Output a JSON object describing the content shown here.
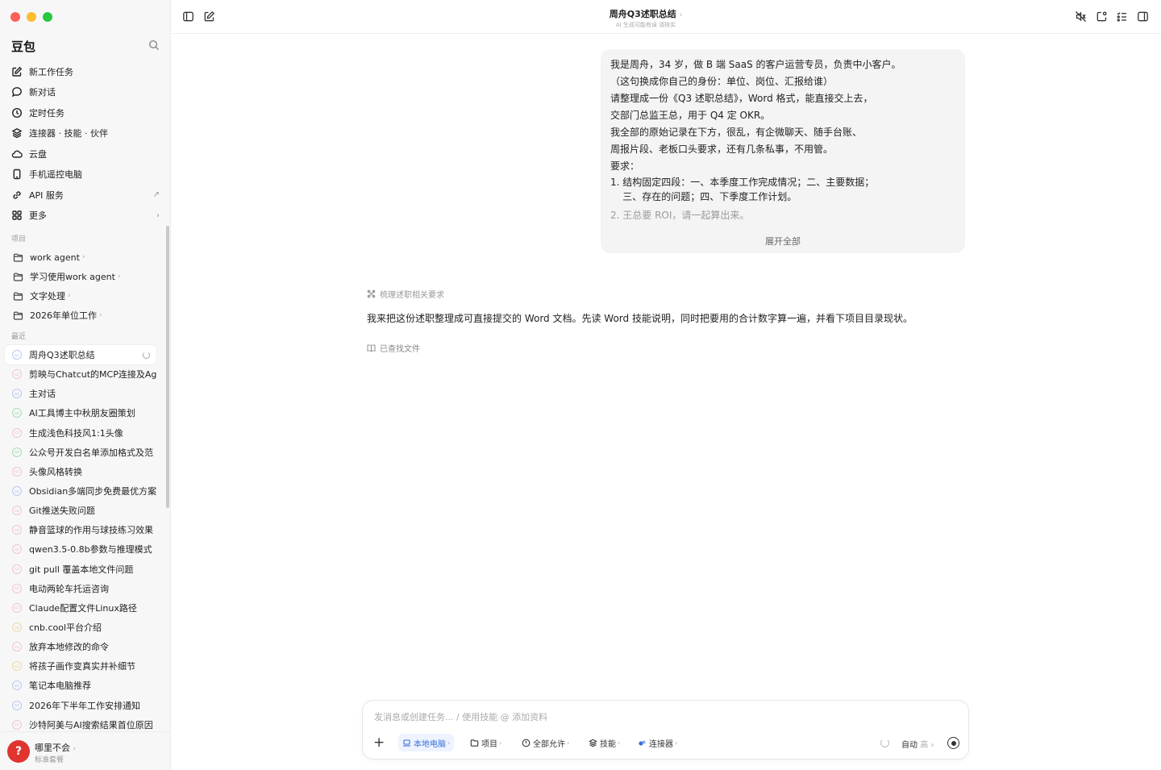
{
  "sidebar": {
    "app_title": "豆包",
    "nav": [
      {
        "label": "新工作任务",
        "icon": "edit-icon"
      },
      {
        "label": "新对话",
        "icon": "chat-icon"
      },
      {
        "label": "定时任务",
        "icon": "clock-icon"
      },
      {
        "label": "连接器 · 技能 · 伙伴",
        "icon": "layers-icon"
      },
      {
        "label": "云盘",
        "icon": "cloud-icon"
      },
      {
        "label": "手机遥控电脑",
        "icon": "phone-icon"
      },
      {
        "label": "API 服务",
        "icon": "link-icon",
        "trail": "↗"
      },
      {
        "label": "更多",
        "icon": "grid-icon",
        "trail": "›"
      }
    ],
    "projects_label": "项目",
    "projects": [
      "work agent",
      "学习使用work agent",
      "文字处理",
      "2026年单位工作"
    ],
    "recent_label": "最近",
    "recent": [
      "周舟Q3述职总结",
      "剪映与Chatcut的MCP连接及Ag",
      "主对话",
      "AI工具博主中秋朋友圈策划",
      "生成浅色科技风1:1头像",
      "公众号开发白名单添加格式及范",
      "头像风格转换",
      "Obsidian多端同步免费最优方案",
      "Git推送失败问题",
      "静音篮球的作用与球技练习效果",
      "qwen3.5-0.8b参数与推理模式",
      "git pull 覆盖本地文件问题",
      "电动两轮车托运咨询",
      "Claude配置文件Linux路径",
      "cnb.cool平台介绍",
      "放弃本地修改的命令",
      "将孩子画作变真实并补细节",
      "笔记本电脑推荐",
      "2026年下半年工作安排通知",
      "沙特阿美与AI搜索结果首位原因"
    ],
    "user": {
      "name": "哪里不会",
      "plan": "标准套餐",
      "avatar_letter": "?"
    }
  },
  "header": {
    "title": "周舟Q3述职总结",
    "subtitle": "AI 生成可能有误 请核实"
  },
  "chat": {
    "user_message_lines": [
      "我是周舟，34 岁，做 B 端 SaaS 的客户运营专员，负责中小客户。",
      "（这句换成你自己的身份：单位、岗位、汇报给谁）",
      "请整理成一份《Q3 述职总结》，Word 格式，能直接交上去，",
      "交部门总监王总，用于 Q4 定 OKR。",
      "我全部的原始记录在下方，很乱，有企微聊天、随手台账、",
      "周报片段、老板口头要求，还有几条私事，不用管。",
      "要求：",
      "1. 结构固定四段：一、本季度工作完成情况；二、主要数据；",
      "    三、存在的问题；四、下季度工作计划。",
      "2. 王总要 ROI，请一起算出来。"
    ],
    "expand_label": "展开全部",
    "step_label": "梳理述职相关要求",
    "assistant_text": "我来把这份述职整理成可直接提交的 Word 文档。先读 Word 技能说明，同时把要用的合计数字算一遍，并看下项目目录现状。",
    "found_label": "已查找文件"
  },
  "composer": {
    "placeholder": "发消息或创建任务... / 使用技能 @ 添加资料",
    "chips": {
      "local": "本地电脑",
      "project": "项目",
      "permission": "全部允许",
      "skills": "技能",
      "connectors": "连接器"
    },
    "mode": "自动",
    "mode_level": "高"
  },
  "colors": {
    "accent": "#3b6fd8",
    "close": "#ff5f57",
    "minimize": "#febc2e",
    "maximize": "#28c840",
    "avatar": "#e0342f"
  }
}
